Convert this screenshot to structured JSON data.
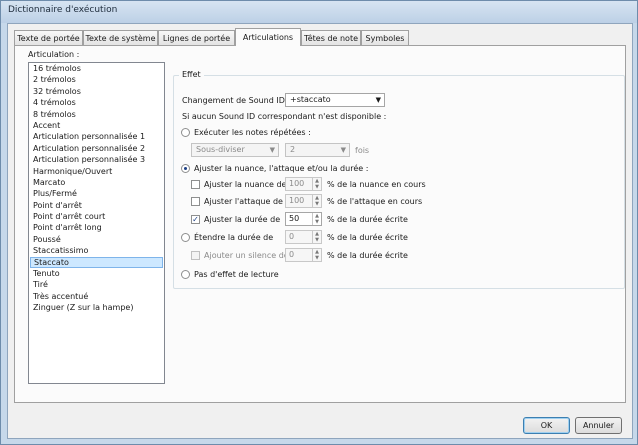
{
  "window": {
    "title": "Dictionnaire d'exécution"
  },
  "tabs": [
    {
      "label": "Texte de portée"
    },
    {
      "label": "Texte de système"
    },
    {
      "label": "Lignes de portée"
    },
    {
      "label": "Articulations"
    },
    {
      "label": "Têtes de note"
    },
    {
      "label": "Symboles"
    }
  ],
  "articulation_list": {
    "label": "Articulation :",
    "selected": "Staccato",
    "items": [
      "16 trémolos",
      "2 trémolos",
      "32 trémolos",
      "4 trémolos",
      "8 trémolos",
      "Accent",
      "Articulation personnalisée 1",
      "Articulation personnalisée 2",
      "Articulation personnalisée 3",
      "Harmonique/Ouvert",
      "Marcato",
      "Plus/Fermé",
      "Point d'arrêt",
      "Point d'arrêt court",
      "Point d'arrêt long",
      "Poussé",
      "Staccatissimo",
      "Staccato",
      "Tenuto",
      "Tiré",
      "Très accentué",
      "Zinguer (Z sur la hampe)"
    ]
  },
  "effect": {
    "legend": "Effet",
    "sound_id_label": "Changement de Sound ID :",
    "sound_id_value": "+staccato",
    "fallback_label": "Si aucun Sound ID correspondant n'est disponible :",
    "radio_repeat": "Exécuter les notes répétées :",
    "subdivide_value": "Sous-diviser",
    "times_value": "2",
    "times_suffix": "fois",
    "radio_adjust": "Ajuster la nuance, l'attaque et/ou la durée :",
    "adjust_dynamic_label": "Ajuster la nuance de",
    "adjust_dynamic_value": "100",
    "adjust_dynamic_suffix": "% de la nuance en cours",
    "adjust_attack_label": "Ajuster l'attaque de",
    "adjust_attack_value": "100",
    "adjust_attack_suffix": "% de l'attaque en cours",
    "adjust_duration_label": "Ajuster la durée de",
    "adjust_duration_value": "50",
    "adjust_duration_suffix": "% de la durée écrite",
    "radio_extend": "Étendre la durée de",
    "extend_value": "0",
    "extend_suffix": "% de la durée écrite",
    "silence_label": "Ajouter un silence de",
    "silence_value": "0",
    "silence_suffix": "% de la durée écrite",
    "radio_none": "Pas d'effet de lecture"
  },
  "buttons": {
    "ok": "OK",
    "cancel": "Annuler"
  }
}
